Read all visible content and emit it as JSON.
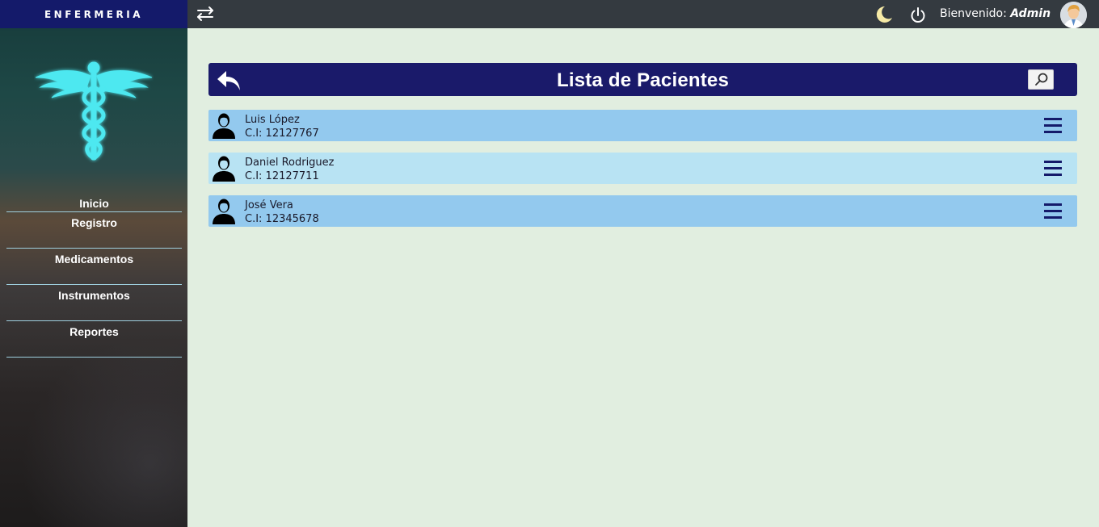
{
  "sidebar": {
    "title": "ENFERMERIA",
    "logo_icon": "caduceus-icon",
    "items": [
      {
        "label": "Inicio"
      },
      {
        "label": "Registro"
      },
      {
        "label": "Medicamentos"
      },
      {
        "label": "Instrumentos"
      },
      {
        "label": "Reportes"
      }
    ]
  },
  "topbar": {
    "toggle_icon": "swap-arrows-icon",
    "theme_icon": "moon-icon",
    "logout_icon": "power-icon",
    "welcome_label": "Bienvenido:",
    "user_name": "Admin",
    "avatar_icon": "user-avatar-icon"
  },
  "main": {
    "title": "Lista de Pacientes",
    "back_icon": "back-arrow-icon",
    "search_icon": "search-icon",
    "patients": [
      {
        "name": "Luis López",
        "ci": "C.I: 12127767"
      },
      {
        "name": "Daniel Rodriguez",
        "ci": "C.I: 12127711"
      },
      {
        "name": "José Vera",
        "ci": "C.I: 12345678"
      }
    ]
  },
  "colors": {
    "sidebar_title_bg": "#141a6a",
    "topbar_bg": "#343a40",
    "header_bg": "#1a1a6a",
    "page_bg": "#e1eee0",
    "row_dark": "#93c9ee",
    "row_light": "#b8e3f3",
    "logo_color": "#4de8f0"
  }
}
